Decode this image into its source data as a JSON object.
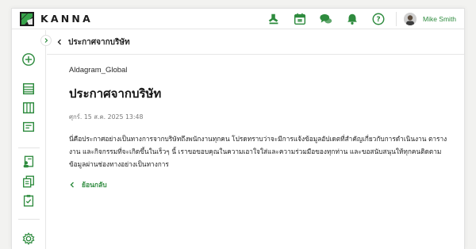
{
  "brand": {
    "name": "KANNA",
    "accent": "#2e8b3e",
    "dark": "#1d1d1d"
  },
  "header": {
    "icons": [
      "stamp-icon",
      "calendar-icon",
      "chat-icon",
      "bell-icon",
      "help-icon"
    ],
    "user": {
      "name": "Mike Smith"
    }
  },
  "sidebar": {
    "items": [
      "add-icon",
      "list-icon",
      "board-icon",
      "document-icon",
      "person-doc-icon",
      "files-icon",
      "clipboard-icon",
      "settings-icon"
    ]
  },
  "page": {
    "title": "ประกาศจากบริษัท",
    "company": "Aldagram_Global",
    "heading": "ประกาศจากบริษัท",
    "datetime": "ศุกร์. 15 ส.ค. 2025 13:48",
    "body": "นี่คือประกาศอย่างเป็นทางการจากบริษัทถึงพนักงานทุกคน โปรดทราบว่าจะมีการแจ้งข้อมูลอัปเดตที่สำคัญเกี่ยวกับการดำเนินงาน ตารางงาน และกิจกรรมที่จะเกิดขึ้นในเร็วๆ นี้ เราขอขอบคุณในความเอาใจใส่และความร่วมมือของทุกท่าน และขอสนับสนุนให้ทุกคนติดตามข้อมูลผ่านช่องทางอย่างเป็นทางการ",
    "back_label": "ย้อนกลับ"
  }
}
